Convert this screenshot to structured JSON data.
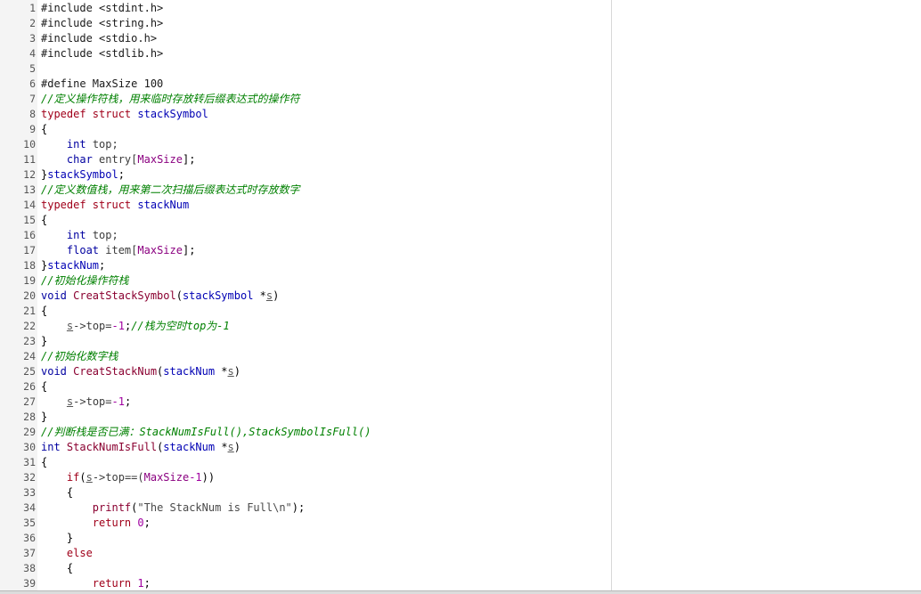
{
  "editor": {
    "lines": [
      {
        "n": "1",
        "tokens": [
          {
            "t": "#include <stdint.h>",
            "c": "pp"
          }
        ]
      },
      {
        "n": "2",
        "tokens": [
          {
            "t": "#include <string.h>",
            "c": "pp"
          }
        ]
      },
      {
        "n": "3",
        "tokens": [
          {
            "t": "#include <stdio.h>",
            "c": "pp"
          }
        ]
      },
      {
        "n": "4",
        "tokens": [
          {
            "t": "#include <stdlib.h>",
            "c": "pp"
          }
        ]
      },
      {
        "n": "5",
        "tokens": []
      },
      {
        "n": "6",
        "tokens": [
          {
            "t": "#define MaxSize 100",
            "c": "pp"
          }
        ]
      },
      {
        "n": "7",
        "tokens": [
          {
            "t": "//定义操作符栈，用来临时存放转后缀表达式的操作符",
            "c": "cmt"
          }
        ]
      },
      {
        "n": "8",
        "tokens": [
          {
            "t": "typedef struct ",
            "c": "kw2"
          },
          {
            "t": "stackSymbol",
            "c": "struct"
          }
        ]
      },
      {
        "n": "9",
        "tokens": [
          {
            "t": "{",
            "c": "op"
          }
        ]
      },
      {
        "n": "10",
        "tokens": [
          {
            "t": "    ",
            "c": "plain"
          },
          {
            "t": "int",
            "c": "kw"
          },
          {
            "t": " top;",
            "c": "ident"
          }
        ]
      },
      {
        "n": "11",
        "tokens": [
          {
            "t": "    ",
            "c": "plain"
          },
          {
            "t": "char",
            "c": "kw"
          },
          {
            "t": " entry[",
            "c": "ident"
          },
          {
            "t": "MaxSize",
            "c": "macro"
          },
          {
            "t": "];",
            "c": "op"
          }
        ]
      },
      {
        "n": "12",
        "tokens": [
          {
            "t": "}",
            "c": "op"
          },
          {
            "t": "stackSymbol",
            "c": "struct"
          },
          {
            "t": ";",
            "c": "op"
          }
        ]
      },
      {
        "n": "13",
        "tokens": [
          {
            "t": "//定义数值栈，用来第二次扫描后缀表达式时存放数字",
            "c": "cmt"
          }
        ]
      },
      {
        "n": "14",
        "tokens": [
          {
            "t": "typedef struct ",
            "c": "kw2"
          },
          {
            "t": "stackNum",
            "c": "struct"
          }
        ]
      },
      {
        "n": "15",
        "tokens": [
          {
            "t": "{",
            "c": "op"
          }
        ]
      },
      {
        "n": "16",
        "tokens": [
          {
            "t": "    ",
            "c": "plain"
          },
          {
            "t": "int",
            "c": "kw"
          },
          {
            "t": " top;",
            "c": "ident"
          }
        ]
      },
      {
        "n": "17",
        "tokens": [
          {
            "t": "    ",
            "c": "plain"
          },
          {
            "t": "float",
            "c": "kw"
          },
          {
            "t": " item[",
            "c": "ident"
          },
          {
            "t": "MaxSize",
            "c": "macro"
          },
          {
            "t": "];",
            "c": "op"
          }
        ]
      },
      {
        "n": "18",
        "tokens": [
          {
            "t": "}",
            "c": "op"
          },
          {
            "t": "stackNum",
            "c": "struct"
          },
          {
            "t": ";",
            "c": "op"
          }
        ]
      },
      {
        "n": "19",
        "tokens": [
          {
            "t": "//初始化操作符栈",
            "c": "cmt"
          }
        ]
      },
      {
        "n": "20",
        "tokens": [
          {
            "t": "void ",
            "c": "kw"
          },
          {
            "t": "CreatStackSymbol",
            "c": "fn"
          },
          {
            "t": "(",
            "c": "op"
          },
          {
            "t": "stackSymbol",
            "c": "struct"
          },
          {
            "t": " *",
            "c": "op"
          },
          {
            "t": "s",
            "c": "param"
          },
          {
            "t": ")",
            "c": "op"
          }
        ]
      },
      {
        "n": "21",
        "tokens": [
          {
            "t": "{",
            "c": "op"
          }
        ]
      },
      {
        "n": "22",
        "tokens": [
          {
            "t": "    ",
            "c": "plain"
          },
          {
            "t": "s",
            "c": "param"
          },
          {
            "t": "->top=",
            "c": "ident"
          },
          {
            "t": "-1",
            "c": "num"
          },
          {
            "t": ";",
            "c": "op"
          },
          {
            "t": "//栈为空时top为-1",
            "c": "cmt"
          }
        ]
      },
      {
        "n": "23",
        "tokens": [
          {
            "t": "}",
            "c": "op"
          }
        ]
      },
      {
        "n": "24",
        "tokens": [
          {
            "t": "//初始化数字栈",
            "c": "cmt"
          }
        ]
      },
      {
        "n": "25",
        "tokens": [
          {
            "t": "void ",
            "c": "kw"
          },
          {
            "t": "CreatStackNum",
            "c": "fn"
          },
          {
            "t": "(",
            "c": "op"
          },
          {
            "t": "stackNum",
            "c": "struct"
          },
          {
            "t": " *",
            "c": "op"
          },
          {
            "t": "s",
            "c": "param"
          },
          {
            "t": ")",
            "c": "op"
          }
        ]
      },
      {
        "n": "26",
        "tokens": [
          {
            "t": "{",
            "c": "op"
          }
        ]
      },
      {
        "n": "27",
        "tokens": [
          {
            "t": "    ",
            "c": "plain"
          },
          {
            "t": "s",
            "c": "param"
          },
          {
            "t": "->top=",
            "c": "ident"
          },
          {
            "t": "-1",
            "c": "num"
          },
          {
            "t": ";",
            "c": "op"
          }
        ]
      },
      {
        "n": "28",
        "tokens": [
          {
            "t": "}",
            "c": "op"
          }
        ]
      },
      {
        "n": "29",
        "tokens": [
          {
            "t": "//判断栈是否已满：StackNumIsFull(),StackSymbolIsFull()",
            "c": "cmt"
          }
        ]
      },
      {
        "n": "30",
        "tokens": [
          {
            "t": "int ",
            "c": "kw"
          },
          {
            "t": "StackNumIsFull",
            "c": "fn"
          },
          {
            "t": "(",
            "c": "op"
          },
          {
            "t": "stackNum",
            "c": "struct"
          },
          {
            "t": " *",
            "c": "op"
          },
          {
            "t": "s",
            "c": "param"
          },
          {
            "t": ")",
            "c": "op"
          }
        ]
      },
      {
        "n": "31",
        "tokens": [
          {
            "t": "{",
            "c": "op"
          }
        ]
      },
      {
        "n": "32",
        "tokens": [
          {
            "t": "    ",
            "c": "plain"
          },
          {
            "t": "if",
            "c": "kw2"
          },
          {
            "t": "(",
            "c": "op"
          },
          {
            "t": "s",
            "c": "param"
          },
          {
            "t": "->top==(",
            "c": "ident"
          },
          {
            "t": "MaxSize",
            "c": "macro"
          },
          {
            "t": "-1",
            "c": "num"
          },
          {
            "t": "))",
            "c": "op"
          }
        ]
      },
      {
        "n": "33",
        "tokens": [
          {
            "t": "    {",
            "c": "op"
          }
        ]
      },
      {
        "n": "34",
        "tokens": [
          {
            "t": "        ",
            "c": "plain"
          },
          {
            "t": "printf",
            "c": "fn"
          },
          {
            "t": "(",
            "c": "op"
          },
          {
            "t": "\"The StackNum is Full\\n\"",
            "c": "str"
          },
          {
            "t": ");",
            "c": "op"
          }
        ]
      },
      {
        "n": "35",
        "tokens": [
          {
            "t": "        ",
            "c": "plain"
          },
          {
            "t": "return",
            "c": "kw2"
          },
          {
            "t": " ",
            "c": "plain"
          },
          {
            "t": "0",
            "c": "num"
          },
          {
            "t": ";",
            "c": "op"
          }
        ]
      },
      {
        "n": "36",
        "tokens": [
          {
            "t": "    }",
            "c": "op"
          }
        ]
      },
      {
        "n": "37",
        "tokens": [
          {
            "t": "    ",
            "c": "plain"
          },
          {
            "t": "else",
            "c": "kw2"
          }
        ]
      },
      {
        "n": "38",
        "tokens": [
          {
            "t": "    {",
            "c": "op"
          }
        ]
      },
      {
        "n": "39",
        "tokens": [
          {
            "t": "        ",
            "c": "plain"
          },
          {
            "t": "return",
            "c": "kw2"
          },
          {
            "t": " ",
            "c": "plain"
          },
          {
            "t": "1",
            "c": "num"
          },
          {
            "t": ";",
            "c": "op"
          }
        ]
      }
    ]
  }
}
